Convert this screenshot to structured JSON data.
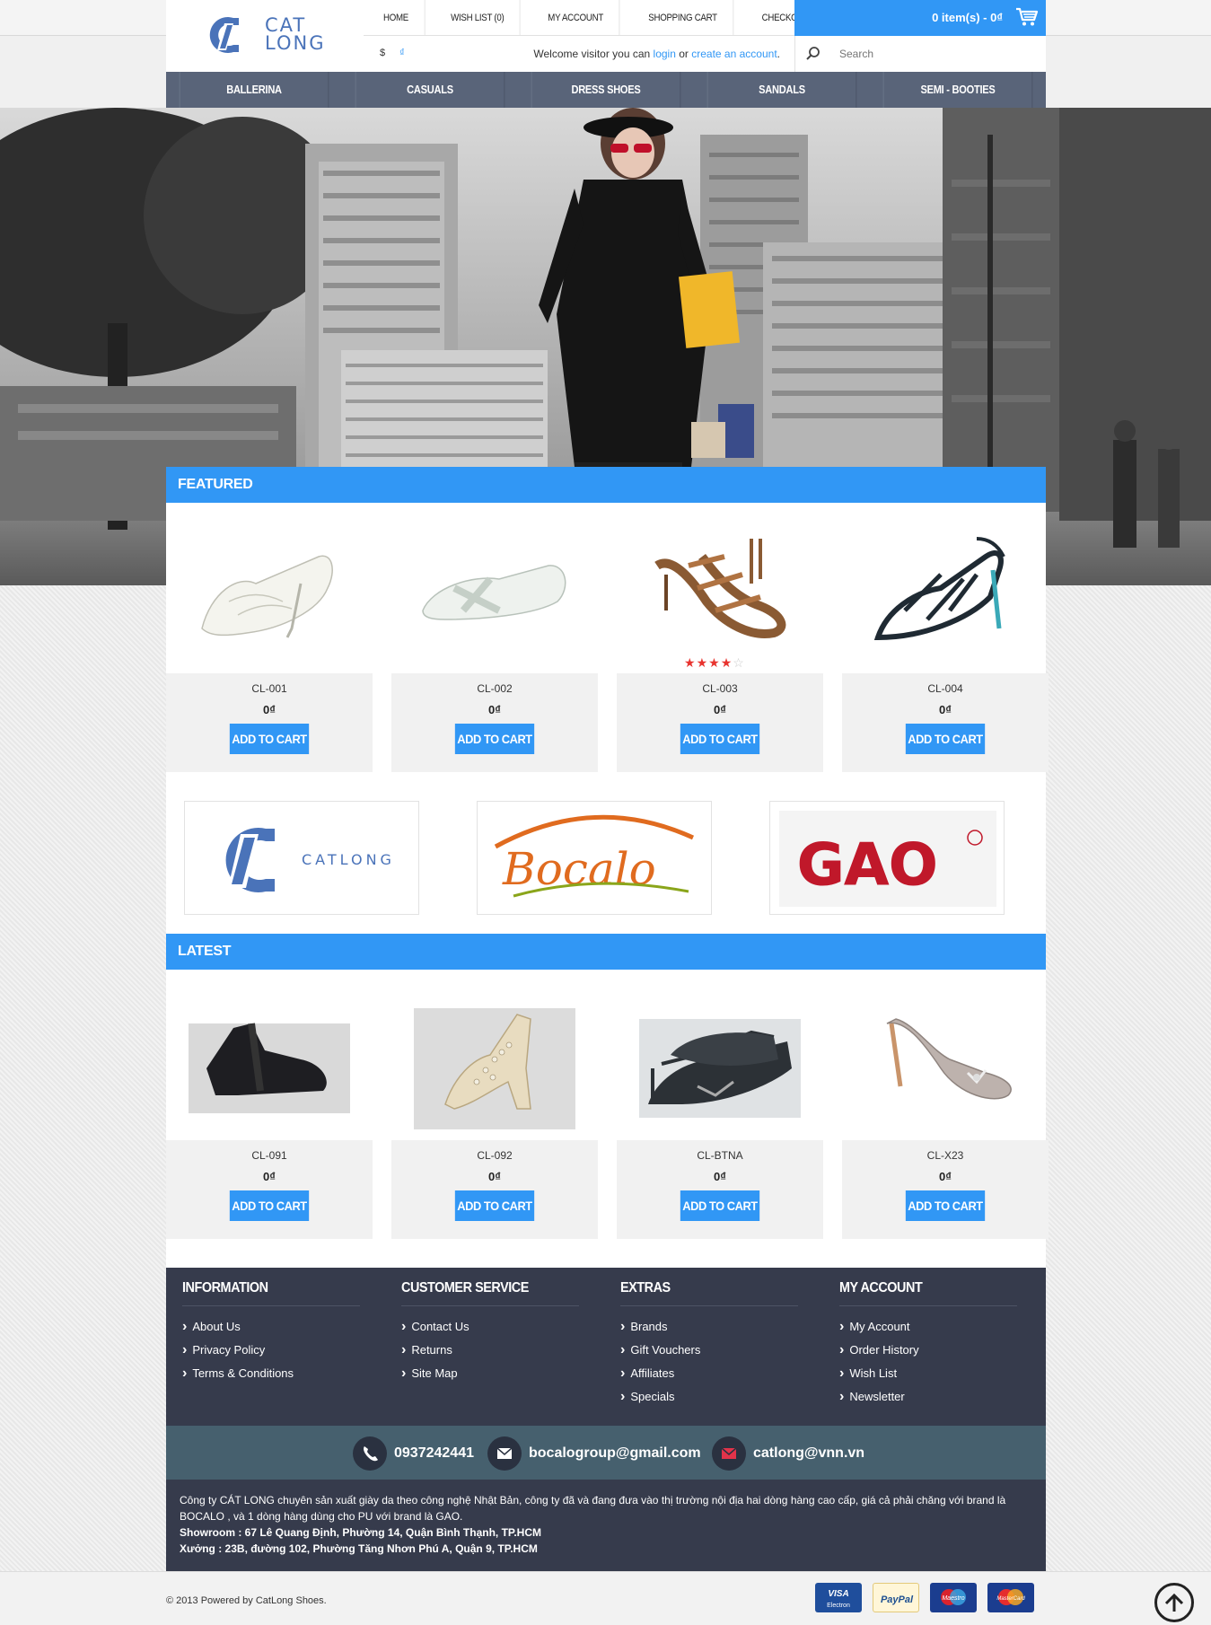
{
  "header": {
    "logo": {
      "line1": "CAT",
      "line2": "LONG"
    },
    "nav": [
      "HOME",
      "WISH LIST (0)",
      "MY ACCOUNT",
      "SHOPPING CART",
      "CHECKOUT"
    ],
    "cart_summary": "0 item(s) - 0₫",
    "currencies": [
      "$",
      "₫"
    ],
    "welcome_prefix": "Welcome visitor you can ",
    "login": "login",
    "or": " or ",
    "create_account": "create an account",
    "search_placeholder": "Search",
    "categories": [
      "BALLERINA",
      "CASUALS",
      "DRESS SHOES",
      "SANDALS",
      "SEMI - BOOTIES"
    ]
  },
  "featured": {
    "title": "FEATURED",
    "products": [
      {
        "name": "CL-001",
        "price": "0₫",
        "button": "ADD TO CART"
      },
      {
        "name": "CL-002",
        "price": "0₫",
        "button": "ADD TO CART"
      },
      {
        "name": "CL-003",
        "price": "0₫",
        "button": "ADD TO CART",
        "rating": 4
      },
      {
        "name": "CL-004",
        "price": "0₫",
        "button": "ADD TO CART"
      }
    ]
  },
  "brands": [
    {
      "name": "CATLONG"
    },
    {
      "name": "Bocalo"
    },
    {
      "name": "GAO"
    }
  ],
  "latest": {
    "title": "LATEST",
    "products": [
      {
        "name": "CL-091",
        "price": "0₫",
        "button": "ADD TO CART"
      },
      {
        "name": "CL-092",
        "price": "0₫",
        "button": "ADD TO CART"
      },
      {
        "name": "CL-BTNA",
        "price": "0₫",
        "button": "ADD TO CART"
      },
      {
        "name": "CL-X23",
        "price": "0₫",
        "button": "ADD TO CART"
      }
    ]
  },
  "footer": {
    "columns": [
      {
        "title": "INFORMATION",
        "links": [
          "About Us",
          "Privacy Policy",
          "Terms & Conditions"
        ]
      },
      {
        "title": "CUSTOMER SERVICE",
        "links": [
          "Contact Us",
          "Returns",
          "Site Map"
        ]
      },
      {
        "title": "EXTRAS",
        "links": [
          "Brands",
          "Gift Vouchers",
          "Affiliates",
          "Specials"
        ]
      },
      {
        "title": "MY ACCOUNT",
        "links": [
          "My Account",
          "Order History",
          "Wish List",
          "Newsletter"
        ]
      }
    ],
    "phone": "0937242441",
    "email1": "bocalogroup@gmail.com",
    "email2": "catlong@vnn.vn",
    "about_text": "Công ty CÁT LONG chuyên sản xuất giày da theo công nghệ Nhật Bản, công ty đã và đang đưa vào thị trường nội địa hai dòng hàng cao cấp, giá cả phải chăng với brand là BOCALO , và 1 dòng hàng dùng cho PU với brand là GAO.",
    "showroom": "Showroom : 67 Lê Quang Định, Phường 14, Quận Bình Thạnh, TP.HCM",
    "factory": "Xưởng : 23B, đường 102, Phường Tăng Nhơn Phú A, Quận 9, TP.HCM",
    "copyright": "© 2013 Powered by CatLong Shoes.",
    "payments": [
      "VISA Electron",
      "PayPal",
      "Maestro",
      "MasterCard"
    ]
  },
  "colors": {
    "accent": "#3197f5",
    "nav_dark": "#596479",
    "footer_dark": "#363b4c",
    "contact_bar": "#46606e",
    "star": "#e8342f"
  }
}
